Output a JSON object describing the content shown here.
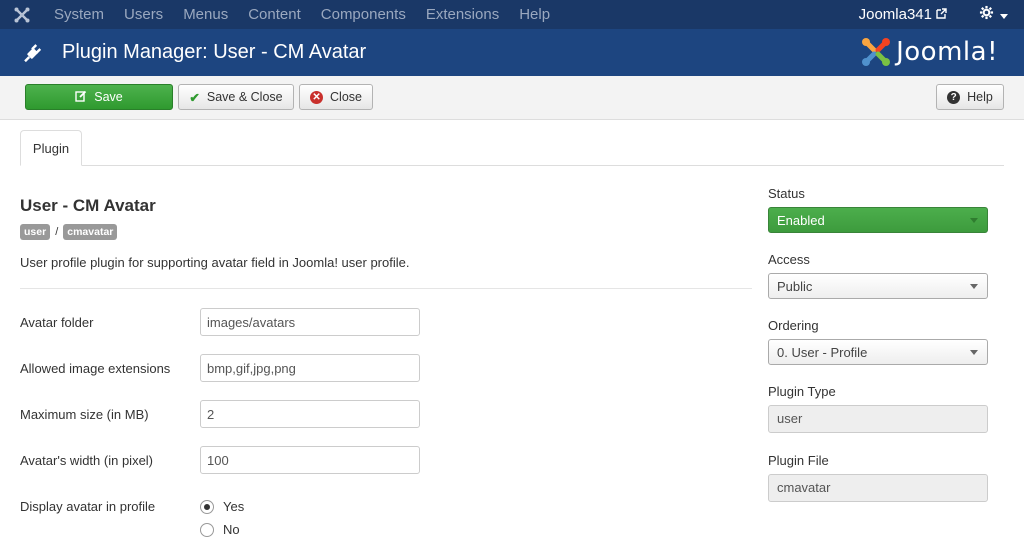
{
  "topnav": {
    "menu": [
      "System",
      "Users",
      "Menus",
      "Content",
      "Components",
      "Extensions",
      "Help"
    ],
    "site_name": "Joomla341"
  },
  "header": {
    "title": "Plugin Manager: User - CM Avatar",
    "brand": "Joomla!"
  },
  "toolbar": {
    "save_label": "Save",
    "save_close_label": "Save & Close",
    "close_label": "Close",
    "help_label": "Help"
  },
  "tabs": {
    "plugin_label": "Plugin"
  },
  "plugin": {
    "title": "User - CM Avatar",
    "group_badge": "user",
    "separator": "/",
    "element_badge": "cmavatar",
    "description": "User profile plugin for supporting avatar field in Joomla! user profile."
  },
  "fields": {
    "avatar_folder": {
      "label": "Avatar folder",
      "value": "images/avatars"
    },
    "extensions": {
      "label": "Allowed image extensions",
      "value": "bmp,gif,jpg,png"
    },
    "max_size": {
      "label": "Maximum size (in MB)",
      "value": "2"
    },
    "width": {
      "label": "Avatar's width (in pixel)",
      "value": "100"
    },
    "display": {
      "label": "Display avatar in profile",
      "yes": "Yes",
      "no": "No",
      "selected": "Yes"
    }
  },
  "sidebar": {
    "status_label": "Status",
    "status_value": "Enabled",
    "access_label": "Access",
    "access_value": "Public",
    "ordering_label": "Ordering",
    "ordering_value": "0. User - Profile",
    "type_label": "Plugin Type",
    "type_value": "user",
    "file_label": "Plugin File",
    "file_value": "cmavatar"
  },
  "colors": {
    "nav_bg": "#1a3867",
    "header_bg": "#1d4580",
    "save_green": "#3d9b3d"
  }
}
